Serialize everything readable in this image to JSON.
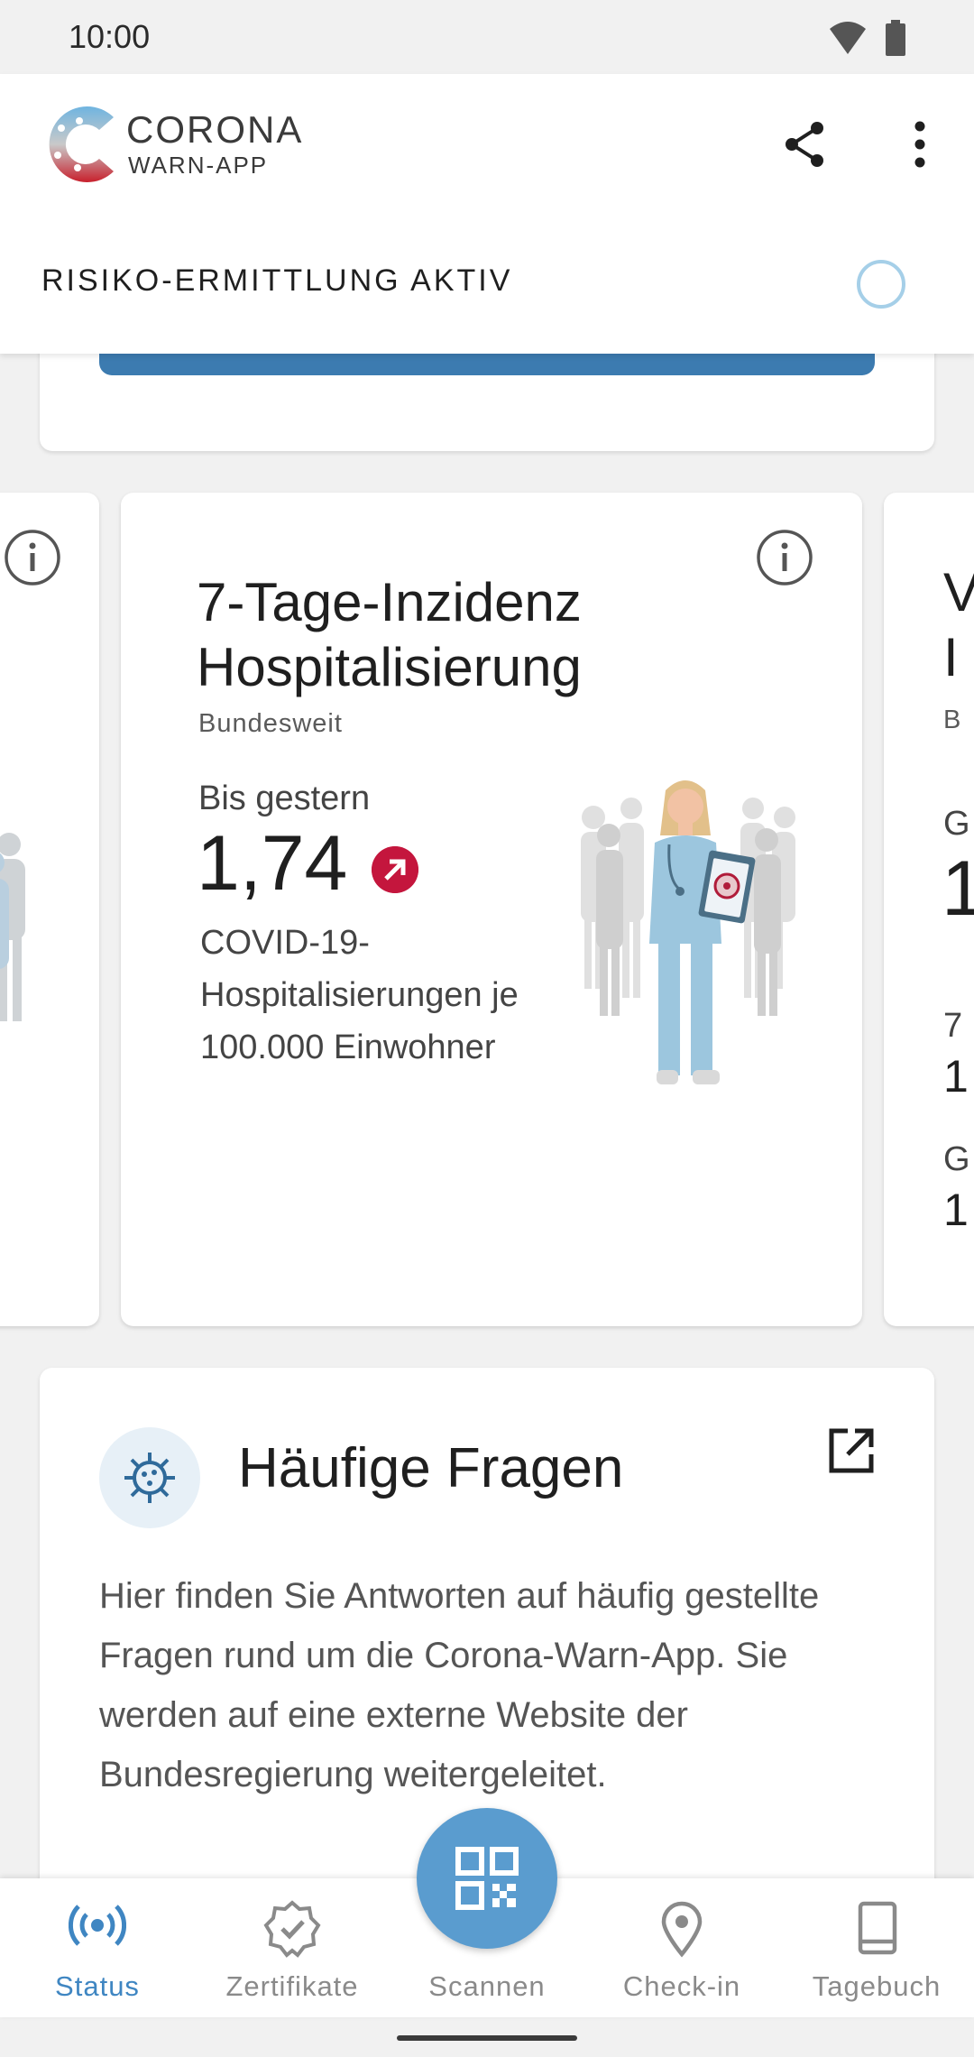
{
  "status_bar": {
    "time": "10:00"
  },
  "app": {
    "brand_line1": "CORONA",
    "brand_line2": "WARN-APP"
  },
  "risk": {
    "label": "RISIKO-ERMITTLUNG AKTIV"
  },
  "stat_card": {
    "title_line1": "7-Tage-Inzidenz",
    "title_line2": "Hospitalisierung",
    "region": "Bundesweit",
    "period_label": "Bis gestern",
    "value": "1,74",
    "trend": "up",
    "description": "COVID-19-Hospitalisierungen je 100.000 Einwohner"
  },
  "faq": {
    "title": "Häufige Fragen",
    "body": "Hier finden Sie Antworten auf häufig gestellte Fragen rund um die Corona-Warn-App. Sie werden auf eine externe Website der Bundesregierung weitergeleitet."
  },
  "nav": {
    "items": [
      {
        "label": "Status"
      },
      {
        "label": "Zertifikate"
      },
      {
        "label": "Scannen"
      },
      {
        "label": "Check-in"
      },
      {
        "label": "Tagebuch"
      }
    ]
  },
  "colors": {
    "accent": "#3f86c2",
    "trend_red": "#c4163d",
    "bar_blue": "#3c7bb0"
  }
}
